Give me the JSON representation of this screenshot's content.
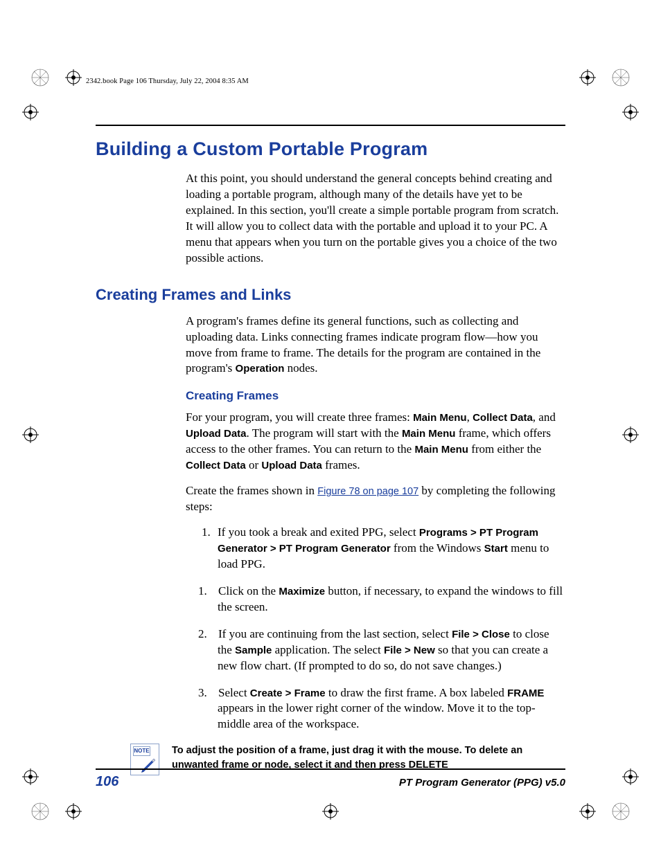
{
  "header_line": "2342.book  Page 106  Thursday, July 22, 2004  8:35 AM",
  "h1": "Building a Custom Portable Program",
  "intro_para": "At this point, you should understand the general concepts behind creating and loading a portable program, although many of the details have yet to be explained. In this section, you'll create a simple portable program from scratch. It will allow you to collect data with the portable and upload it to your PC. A menu that appears when you turn on the portable gives you a choice of the two possible actions.",
  "h2": "Creating Frames and Links",
  "frames_para_pre": "A program's frames define its general functions, such as collecting and uploading data. Links connecting frames indicate program flow—how you move from frame to frame. The details for the program are contained in the program's ",
  "frames_para_bold": "Operation",
  "frames_para_post": " nodes.",
  "h3": "Creating Frames",
  "p3_a": "For your program, you will create three frames: ",
  "p3_b1": "Main Menu",
  "p3_c": ", ",
  "p3_b2": "Collect Data",
  "p3_d": ", and ",
  "p3_b3": "Upload Data",
  "p3_e": ". The program will start with the ",
  "p3_b4": "Main Menu",
  "p3_f": " frame, which offers access to the other frames. You can return to the ",
  "p3_b5": "Main Menu",
  "p3_g": " from either the ",
  "p3_b6": "Collect Data",
  "p3_h": " or ",
  "p3_b7": "Upload Data",
  "p3_i": " frames.",
  "p4_a": "Create the frames shown in ",
  "p4_link": "Figure 78 on page 107",
  "p4_b": " by completing the following steps:",
  "steps": {
    "s1_a": "If you took a break and exited PPG, select ",
    "s1_b1": "Programs > PT Program Generator > PT Program Generator",
    "s1_c": " from the Windows ",
    "s1_b2": "Start",
    "s1_d": " menu to load PPG.",
    "s2_a": "Click on the ",
    "s2_b1": "Maximize",
    "s2_c": " button, if necessary, to expand the windows to fill the screen.",
    "s3_a": "If you are continuing from the last section, select ",
    "s3_b1": "File > Close",
    "s3_c": " to close the ",
    "s3_b2": "Sample",
    "s3_d": " application. The select ",
    "s3_b3": "File > New",
    "s3_e": " so that you can create a new flow chart. (If prompted to do so, do not save changes.)",
    "s4_a": "Select ",
    "s4_b1": "Create > Frame",
    "s4_c": " to draw the first frame. A box labeled ",
    "s4_b2": "FRAME",
    "s4_d": " appears in the lower right corner of the window. Move it to the top-middle area of the workspace."
  },
  "note_label": "NOTE",
  "note_a": "To adjust the position of a frame, just drag it with the mouse. To delete an unwanted frame or node, select it and then press ",
  "note_b": "DELETE",
  "footer": {
    "page": "106",
    "title": "PT Program Generator (PPG)  v5.0"
  }
}
